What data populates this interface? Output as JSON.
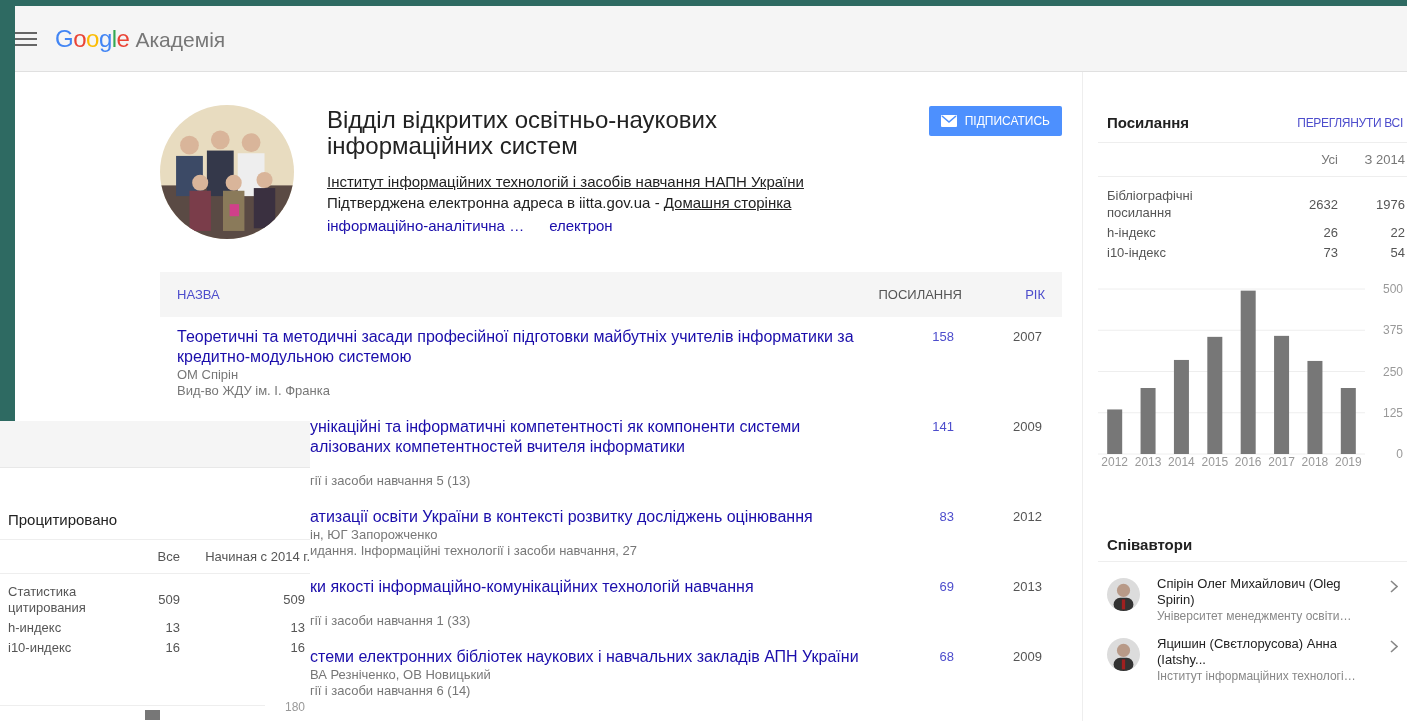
{
  "header": {
    "logo": "Google",
    "product": "Академія"
  },
  "profile": {
    "name_lines": [
      "Відділ відкритих освітньо-наукових",
      "інформаційних систем"
    ],
    "affiliation": "Інститут інформаційних технологій і засобів навчання НАПН України",
    "email_text": "Підтверджена електронна адреса в iitta.gov.ua - ",
    "homepage": "Домашня сторінка",
    "interests": [
      "інформаційно-аналітична …",
      "електрон"
    ],
    "subscribe": "ПІДПИСАТИСЬ"
  },
  "table": {
    "columns": [
      {
        "label": "НАЗВА",
        "kind": "link"
      },
      {
        "label": "ПОСИЛАННЯ",
        "kind": "plain"
      },
      {
        "label": "РІК",
        "kind": "link"
      }
    ],
    "rows": [
      {
        "covered": false,
        "title_lines": [
          "Теоретичні та методичні засади професійної підготовки майбутніх учителів інформатики за",
          "кредитно-модульною системою"
        ],
        "authors": "ОМ Спірін",
        "venue": "Вид-во ЖДУ ім. І. Франка",
        "cited": "158",
        "year": "2007"
      },
      {
        "covered": true,
        "title_lines": [
          "унікаційні та інформатичні компетентності як компоненти системи",
          "алізованих компетентностей вчителя інформатики"
        ],
        "venue": "гії і засоби навчання 5 (13)",
        "cited": "141",
        "year": "2009"
      },
      {
        "covered": true,
        "title_lines": [
          "атизації освіти України в контексті розвитку досліджень оцінювання"
        ],
        "authors": "ін, ЮГ Запорожченко",
        "venue": "идання. Інформаційні технології і засоби навчання, 27",
        "cited": "83",
        "year": "2012"
      },
      {
        "covered": true,
        "title_lines": [
          "ки якості інформаційно-комунікаційних технологій навчання"
        ],
        "venue": "гії і засоби навчання 1 (33)",
        "cited": "69",
        "year": "2013"
      },
      {
        "covered": true,
        "title_lines": [
          "стеми електронних бібліотек наукових і навчальних закладів АПН України"
        ],
        "authors": "ВА Резніченко, ОВ Новицький",
        "venue": "гії і засоби навчання 6 (14)",
        "cited": "68",
        "year": "2009"
      }
    ]
  },
  "citations": {
    "title": "Посилання",
    "view_all": "ПЕРЕГЛЯНУТИ ВСІ",
    "columns": [
      "Усі",
      "З 2014"
    ],
    "rows": [
      {
        "label": "Бібліографічні посилання",
        "all": "2632",
        "since": "1976"
      },
      {
        "label": "h-індекс",
        "all": "26",
        "since": "22"
      },
      {
        "label": "i10-індекс",
        "all": "73",
        "since": "54"
      }
    ],
    "chart_data": {
      "type": "bar",
      "categories": [
        "2012",
        "2013",
        "2014",
        "2015",
        "2016",
        "2017",
        "2018",
        "2019"
      ],
      "grid": true,
      "series": [
        {
          "color": "#777777",
          "values": [
            135,
            200,
            285,
            355,
            495,
            358,
            282,
            200
          ]
        }
      ],
      "ylim": [
        0,
        500
      ],
      "yticks": [
        0,
        125,
        250,
        375,
        500
      ]
    }
  },
  "coauthors": {
    "title": "Співавтори",
    "items": [
      {
        "name": "Спірін Олег Михайлович (Oleg Spirin)",
        "affiliation": "Університет менеджменту освіти…"
      },
      {
        "name": "Яцишин (Свєтлорусова) Анна (Iatshy...",
        "affiliation": "Інститут інформаційних технологі…"
      }
    ]
  },
  "overlay": {
    "title": "Процитировано",
    "columns": [
      "Все",
      "Начиная с 2014 г."
    ],
    "rows": [
      {
        "label": "Статистика цитирования",
        "all": "509",
        "since": "509"
      },
      {
        "label": "h-индекс",
        "all": "13",
        "since": "13"
      },
      {
        "label": "i10-индекс",
        "all": "16",
        "since": "16"
      }
    ],
    "axis_label": "180"
  }
}
